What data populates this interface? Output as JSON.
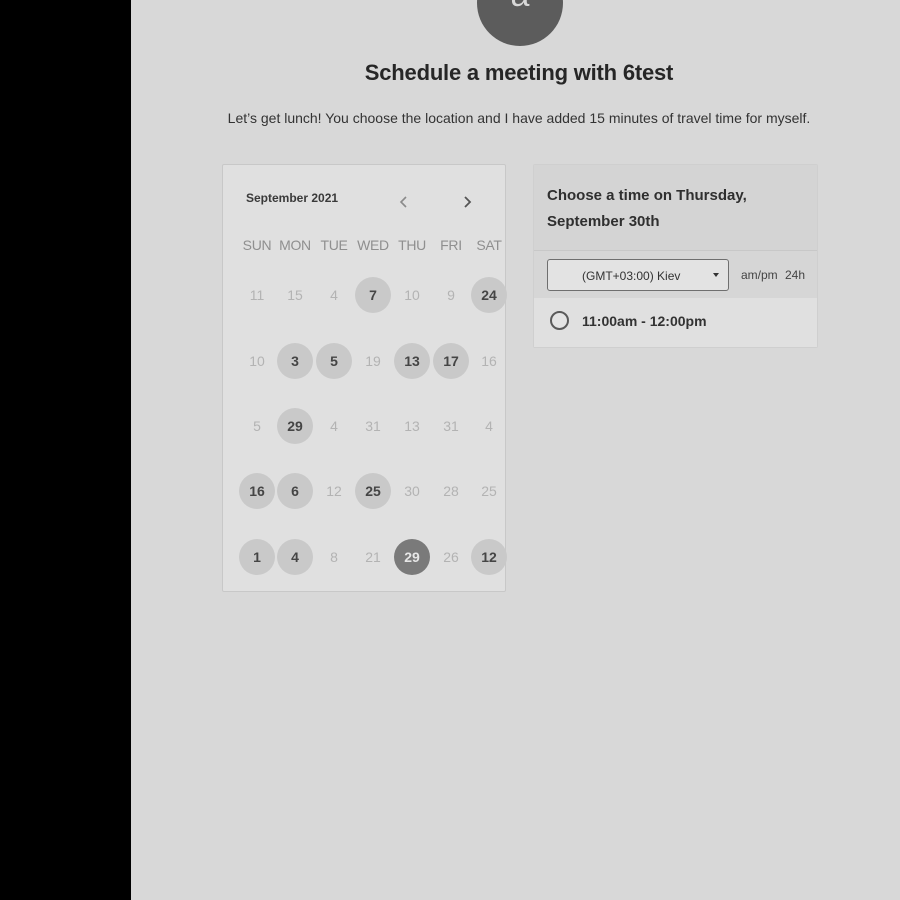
{
  "avatar": {
    "letter": "a"
  },
  "header": {
    "title": "Schedule a meeting with 6test",
    "description": "Let’s get lunch! You choose the location and I have added 15 minutes of travel time for myself."
  },
  "calendar": {
    "month_label": "September 2021",
    "prev_icon": "chevron-left-icon",
    "next_icon": "chevron-right-icon",
    "weekdays": [
      "SUN",
      "MON",
      "TUE",
      "WED",
      "THU",
      "FRI",
      "SAT"
    ],
    "weeks": [
      [
        {
          "label": "11",
          "state": "off"
        },
        {
          "label": "15",
          "state": "off"
        },
        {
          "label": "4",
          "state": "off"
        },
        {
          "label": "7",
          "state": "available"
        },
        {
          "label": "10",
          "state": "off"
        },
        {
          "label": "9",
          "state": "off"
        },
        {
          "label": "24",
          "state": "available"
        }
      ],
      [
        {
          "label": "10",
          "state": "off"
        },
        {
          "label": "3",
          "state": "available"
        },
        {
          "label": "5",
          "state": "available"
        },
        {
          "label": "19",
          "state": "off"
        },
        {
          "label": "13",
          "state": "available"
        },
        {
          "label": "17",
          "state": "available"
        },
        {
          "label": "16",
          "state": "off"
        }
      ],
      [
        {
          "label": "5",
          "state": "off"
        },
        {
          "label": "29",
          "state": "available"
        },
        {
          "label": "4",
          "state": "off"
        },
        {
          "label": "31",
          "state": "off"
        },
        {
          "label": "13",
          "state": "off"
        },
        {
          "label": "31",
          "state": "off"
        },
        {
          "label": "4",
          "state": "off"
        }
      ],
      [
        {
          "label": "16",
          "state": "available"
        },
        {
          "label": "6",
          "state": "available"
        },
        {
          "label": "12",
          "state": "off"
        },
        {
          "label": "25",
          "state": "available"
        },
        {
          "label": "30",
          "state": "off"
        },
        {
          "label": "28",
          "state": "off"
        },
        {
          "label": "25",
          "state": "off"
        }
      ],
      [
        {
          "label": "1",
          "state": "available"
        },
        {
          "label": "4",
          "state": "available"
        },
        {
          "label": "8",
          "state": "off"
        },
        {
          "label": "21",
          "state": "off"
        },
        {
          "label": "29",
          "state": "selected"
        },
        {
          "label": "26",
          "state": "off"
        },
        {
          "label": "12",
          "state": "available"
        }
      ]
    ]
  },
  "time_panel": {
    "title": "Choose a time on Thursday, September 30th",
    "timezone": "(GMT+03:00) Kiev",
    "format_ampm": "am/pm",
    "format_24h": "24h",
    "slots": [
      {
        "label": "11:00am - 12:00pm"
      }
    ]
  },
  "colors": {
    "page_background": "#d8d8d8",
    "available_day": "#c9c9c9",
    "selected_day": "#7a7a7a",
    "side_panel": "#000000"
  }
}
